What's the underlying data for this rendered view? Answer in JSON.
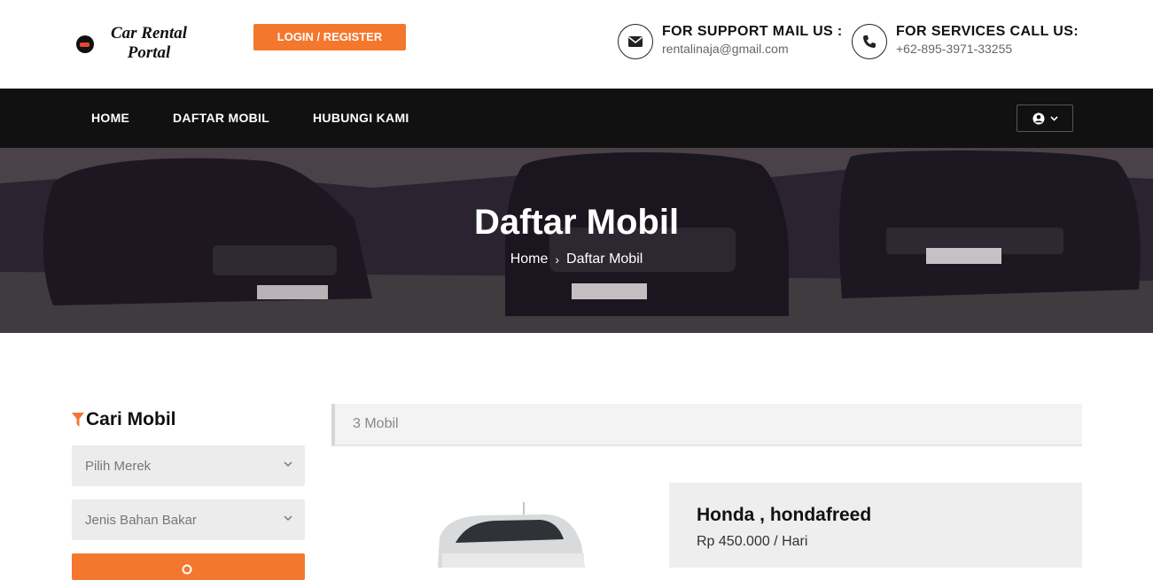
{
  "header": {
    "logo_line1": "Car Rental",
    "logo_line2": "Portal",
    "login_label": "LOGIN / REGISTER",
    "support_title": "FOR SUPPORT MAIL US :",
    "support_value": "rentalinaja@gmail.com",
    "services_title": "FOR SERVICES CALL US:",
    "services_value": "+62-895-3971-33255"
  },
  "nav": {
    "items": [
      {
        "label": "HOME"
      },
      {
        "label": "DAFTAR MOBIL"
      },
      {
        "label": "HUBUNGI KAMI"
      }
    ],
    "user_icon": "user-circle-icon"
  },
  "hero": {
    "title": "Daftar Mobil",
    "breadcrumb": [
      "Home",
      "Daftar Mobil"
    ]
  },
  "sidebar": {
    "title": "Cari Mobil",
    "filter_icon": "filter-icon",
    "brand_select": "Pilih Merek",
    "fuel_select": "Jenis Bahan Bakar"
  },
  "listing": {
    "count_label": "3 Mobil",
    "cars": [
      {
        "name": "Honda , hondafreed",
        "price": "Rp 450.000 / Hari"
      }
    ]
  },
  "colors": {
    "accent": "#f4772e",
    "navbar": "#111111",
    "card_bg": "#eeeeee"
  }
}
